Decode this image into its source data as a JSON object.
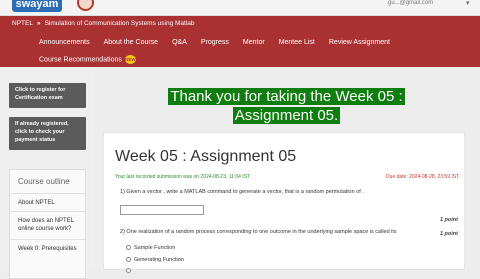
{
  "header": {
    "logo_text": "swayam",
    "user_email": "gu...@gmail.com",
    "caret": "▾"
  },
  "breadcrumb": {
    "root": "NPTEL",
    "separator": "»",
    "course": "Simulation of Communication Systems using Matlab"
  },
  "menu": {
    "items": [
      "Announcements",
      "About the Course",
      "Q&A",
      "Progress",
      "Mentor",
      "Mentee List",
      "Review Assignment"
    ],
    "recommendations": "Course Recommendations",
    "new_badge": "NEW"
  },
  "sidebar": {
    "register_button": "Click to register for Certification exam",
    "status_button": "If already registered, click to check your payment status",
    "outline_title": "Course outline",
    "outline_items": [
      "About NPTEL",
      "How does an NPTEL online course work?",
      "Week 0: Prerequisites"
    ]
  },
  "banner": {
    "line1": "Thank you for taking the Week 05 :",
    "line2": "Assignment 05."
  },
  "assignment": {
    "title": "Week 05 : Assignment 05",
    "last_submission": "Your last recorded submission was on 2024-08-23, 11:04 IST",
    "due_date": "Due date: 2024-08-28, 23:59 IST.",
    "q1": "1)   Given a vector , write a MATLAB command to generate a vector, that is a random permutation of .",
    "q1_points": "1 point",
    "q2": "2)   One realization of a random process corresponding to one outcome in the underlying sample space is called its",
    "q2_points": "1 point",
    "options": [
      "Sample Function",
      "Generating Function",
      ""
    ]
  }
}
